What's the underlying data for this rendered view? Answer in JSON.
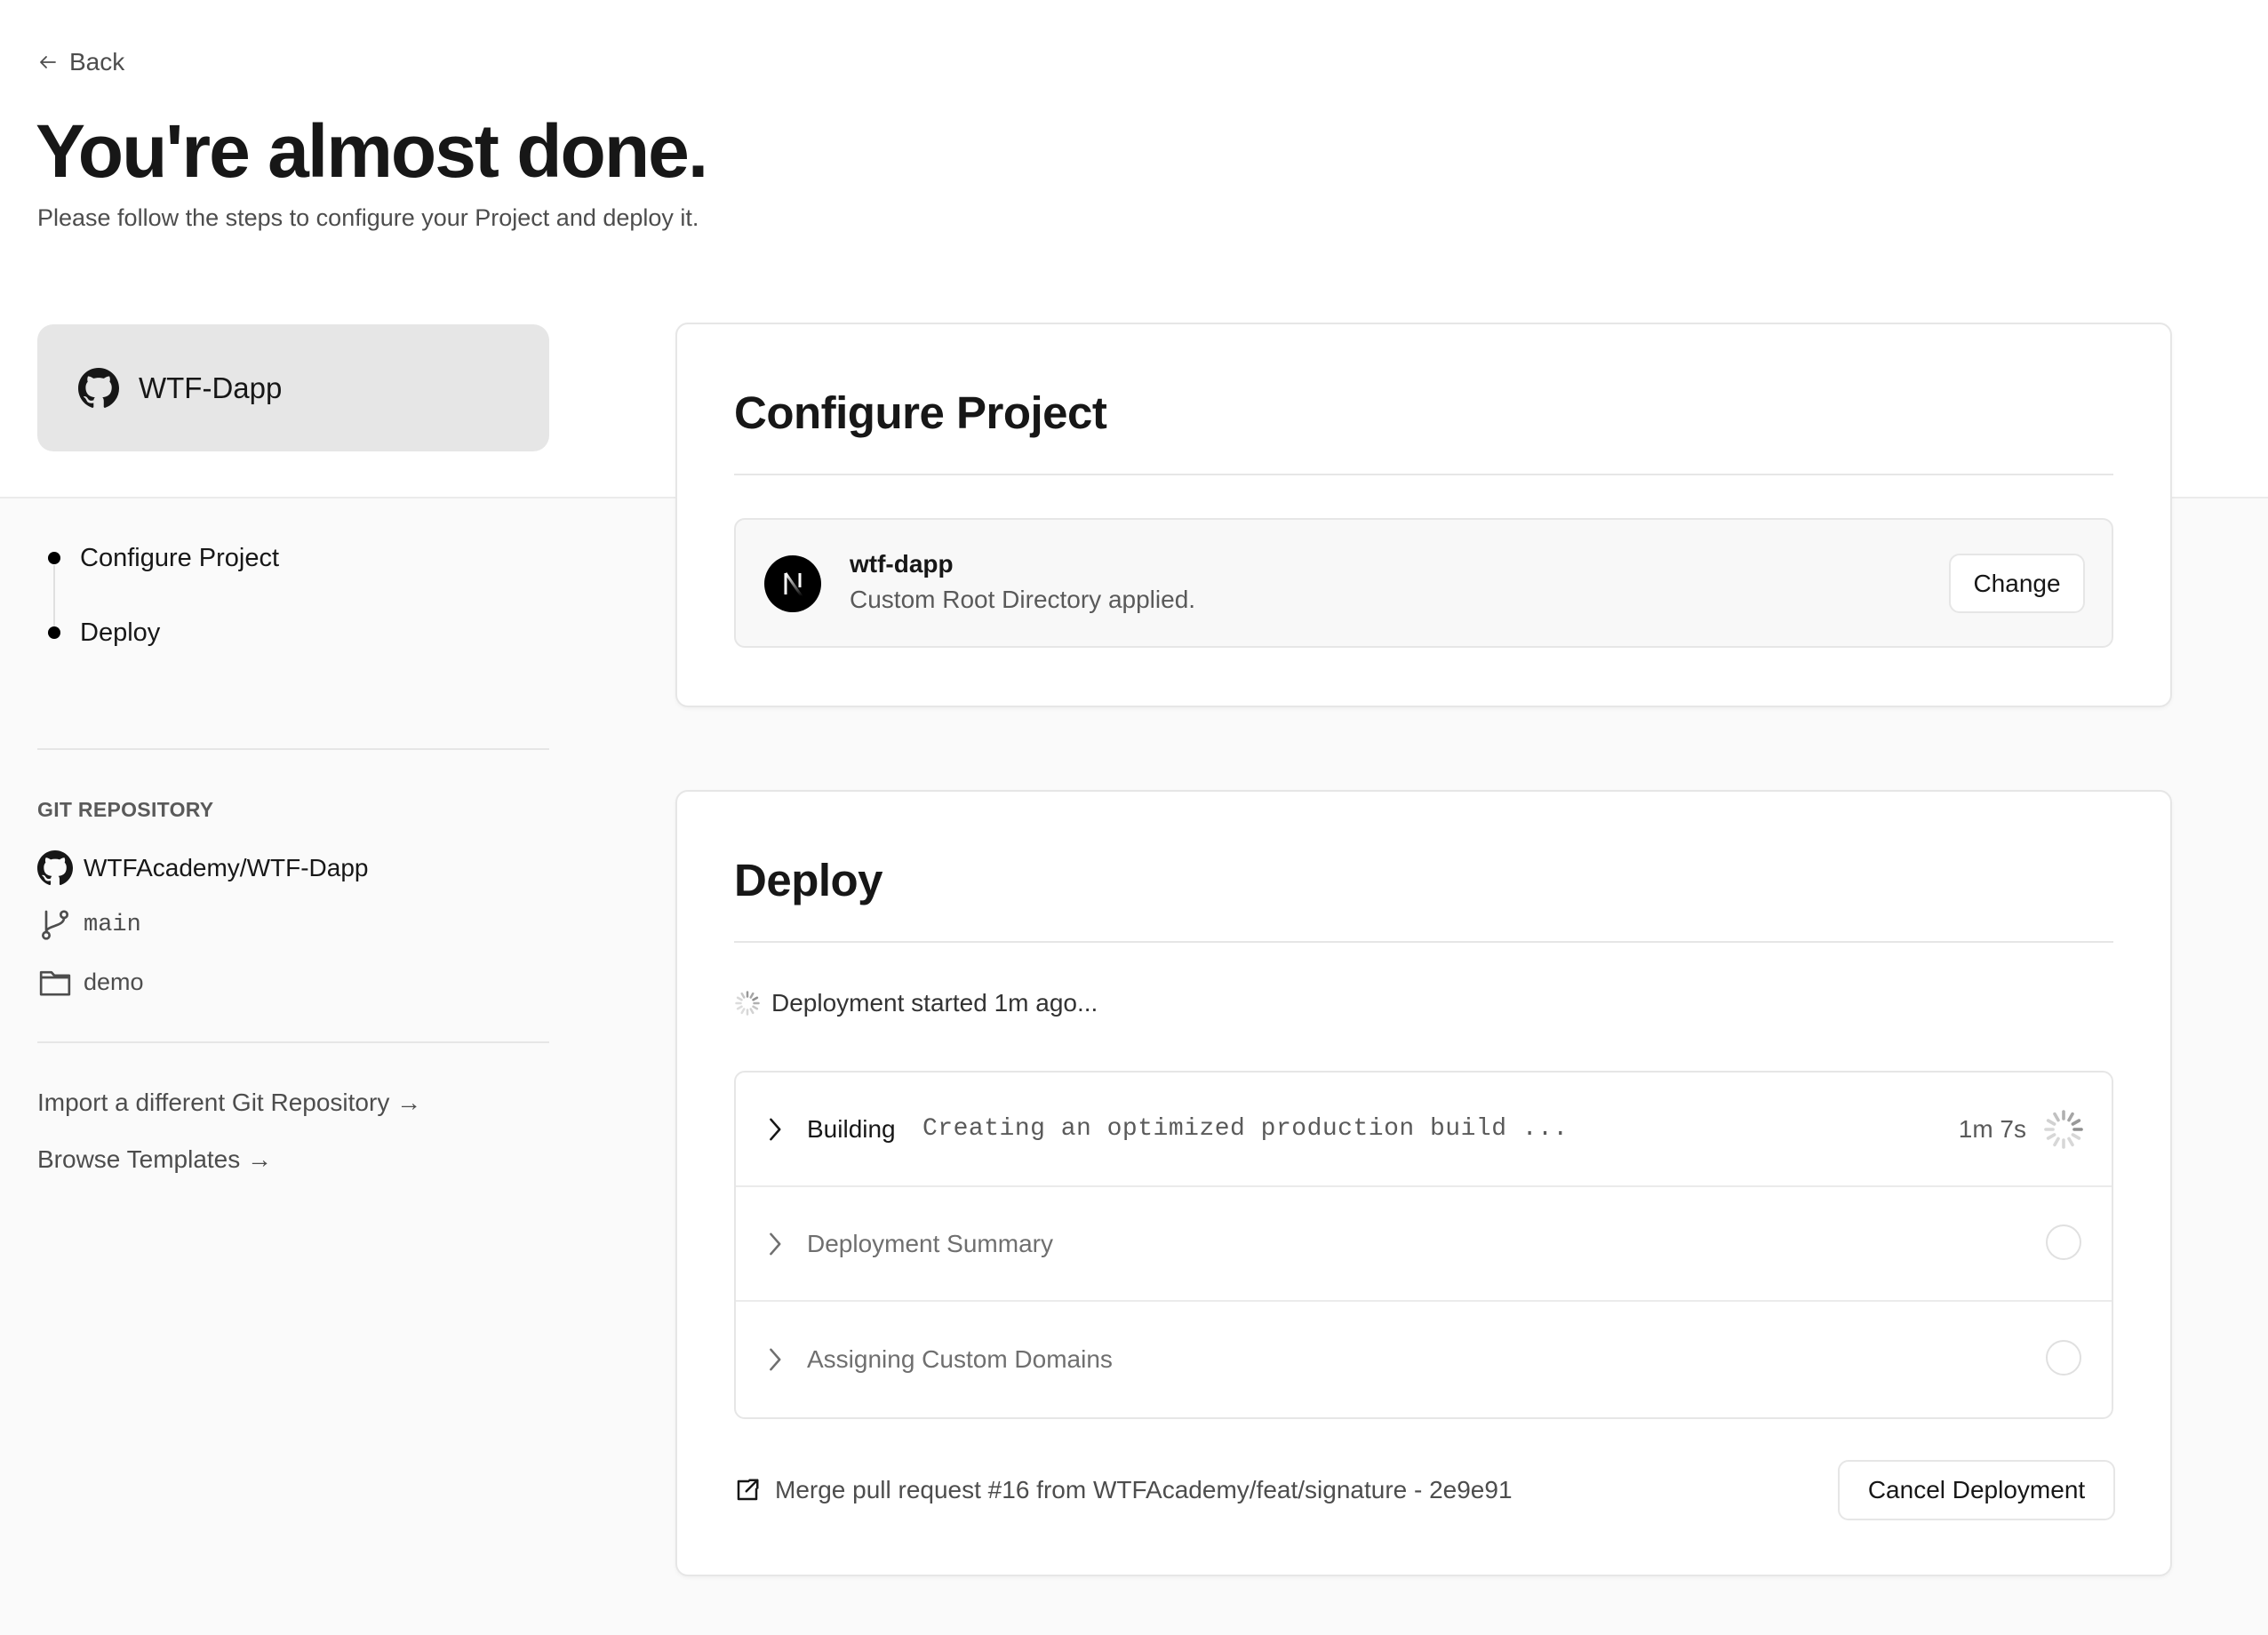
{
  "nav": {
    "back_label": "Back"
  },
  "header": {
    "title": "You're almost done.",
    "subtitle": "Please follow the steps to configure your Project and deploy it."
  },
  "sidebar": {
    "repo_card_name": "WTF-Dapp",
    "steps": [
      {
        "label": "Configure Project"
      },
      {
        "label": "Deploy"
      }
    ],
    "git_section_label": "GIT REPOSITORY",
    "repo_full_name": "WTFAcademy/WTF-Dapp",
    "branch": "main",
    "root_directory": "demo",
    "links": [
      {
        "label": "Import a different Git Repository →"
      },
      {
        "label": "Browse Templates →"
      }
    ]
  },
  "configure": {
    "heading": "Configure Project",
    "project_name": "wtf-dapp",
    "project_note": "Custom Root Directory applied.",
    "change_label": "Change",
    "framework_icon": "nextjs-icon"
  },
  "deploy": {
    "heading": "Deploy",
    "status_text": "Deployment started 1m ago...",
    "steps": [
      {
        "label": "Building",
        "detail": "Creating an optimized production build ...",
        "elapsed": "1m 7s",
        "state": "in-progress"
      },
      {
        "label": "Deployment Summary",
        "state": "pending"
      },
      {
        "label": "Assigning Custom Domains",
        "state": "pending"
      }
    ],
    "commit_message": "Merge pull request #16 from WTFAcademy/feat/signature - 2e9e91",
    "cancel_label": "Cancel Deployment"
  },
  "colors": {
    "text_primary": "#171717",
    "text_secondary": "#4d4d4d",
    "border": "#e6e6e6",
    "page_bg": "#fafafa",
    "repo_card_bg": "#e6e6e6"
  }
}
